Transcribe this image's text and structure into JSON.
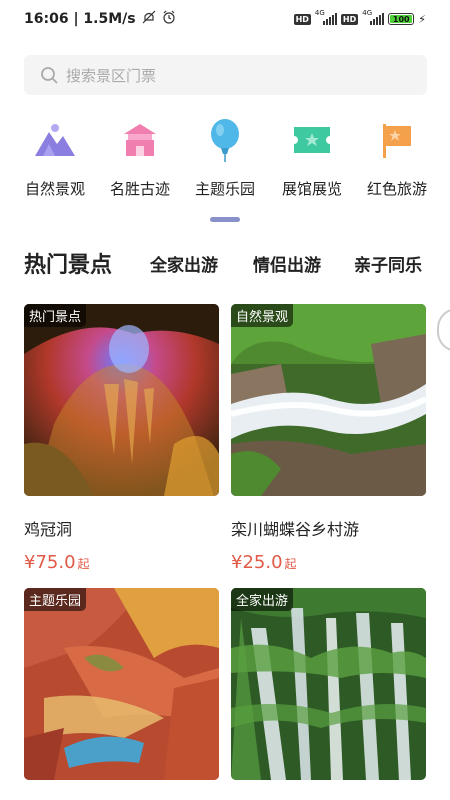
{
  "status_bar": {
    "time_speed": "16:06 | 1.5M/s",
    "hd1": "HD",
    "net1": "4G",
    "hd2": "HD",
    "net2": "4G",
    "battery": "100"
  },
  "search": {
    "placeholder": "搜索景区门票"
  },
  "categories": [
    {
      "label": "自然景观",
      "icon": "mountain-icon",
      "color": "#8a7fe0"
    },
    {
      "label": "名胜古迹",
      "icon": "pavilion-icon",
      "color": "#f07fb0"
    },
    {
      "label": "主题乐园",
      "icon": "balloon-icon",
      "color": "#4fb8e8"
    },
    {
      "label": "展馆展览",
      "icon": "ticket-icon",
      "color": "#3ec9a0"
    },
    {
      "label": "红色旅游",
      "icon": "flag-icon",
      "color": "#f5a04a"
    }
  ],
  "tabs": [
    {
      "label": "热门景点",
      "active": true
    },
    {
      "label": "全家出游",
      "active": false
    },
    {
      "label": "情侣出游",
      "active": false
    },
    {
      "label": "亲子同乐",
      "active": false
    }
  ],
  "cards": [
    {
      "tag": "热门景点",
      "name": "鸡冠洞",
      "price": "¥75.0",
      "unit": "起"
    },
    {
      "tag": "自然景观",
      "name": "栾川蝴蝶谷乡村游",
      "price": "¥25.0",
      "unit": "起"
    },
    {
      "tag": "主题乐园",
      "name": "",
      "price": "",
      "unit": ""
    },
    {
      "tag": "全家出游",
      "name": "",
      "price": "",
      "unit": ""
    }
  ]
}
